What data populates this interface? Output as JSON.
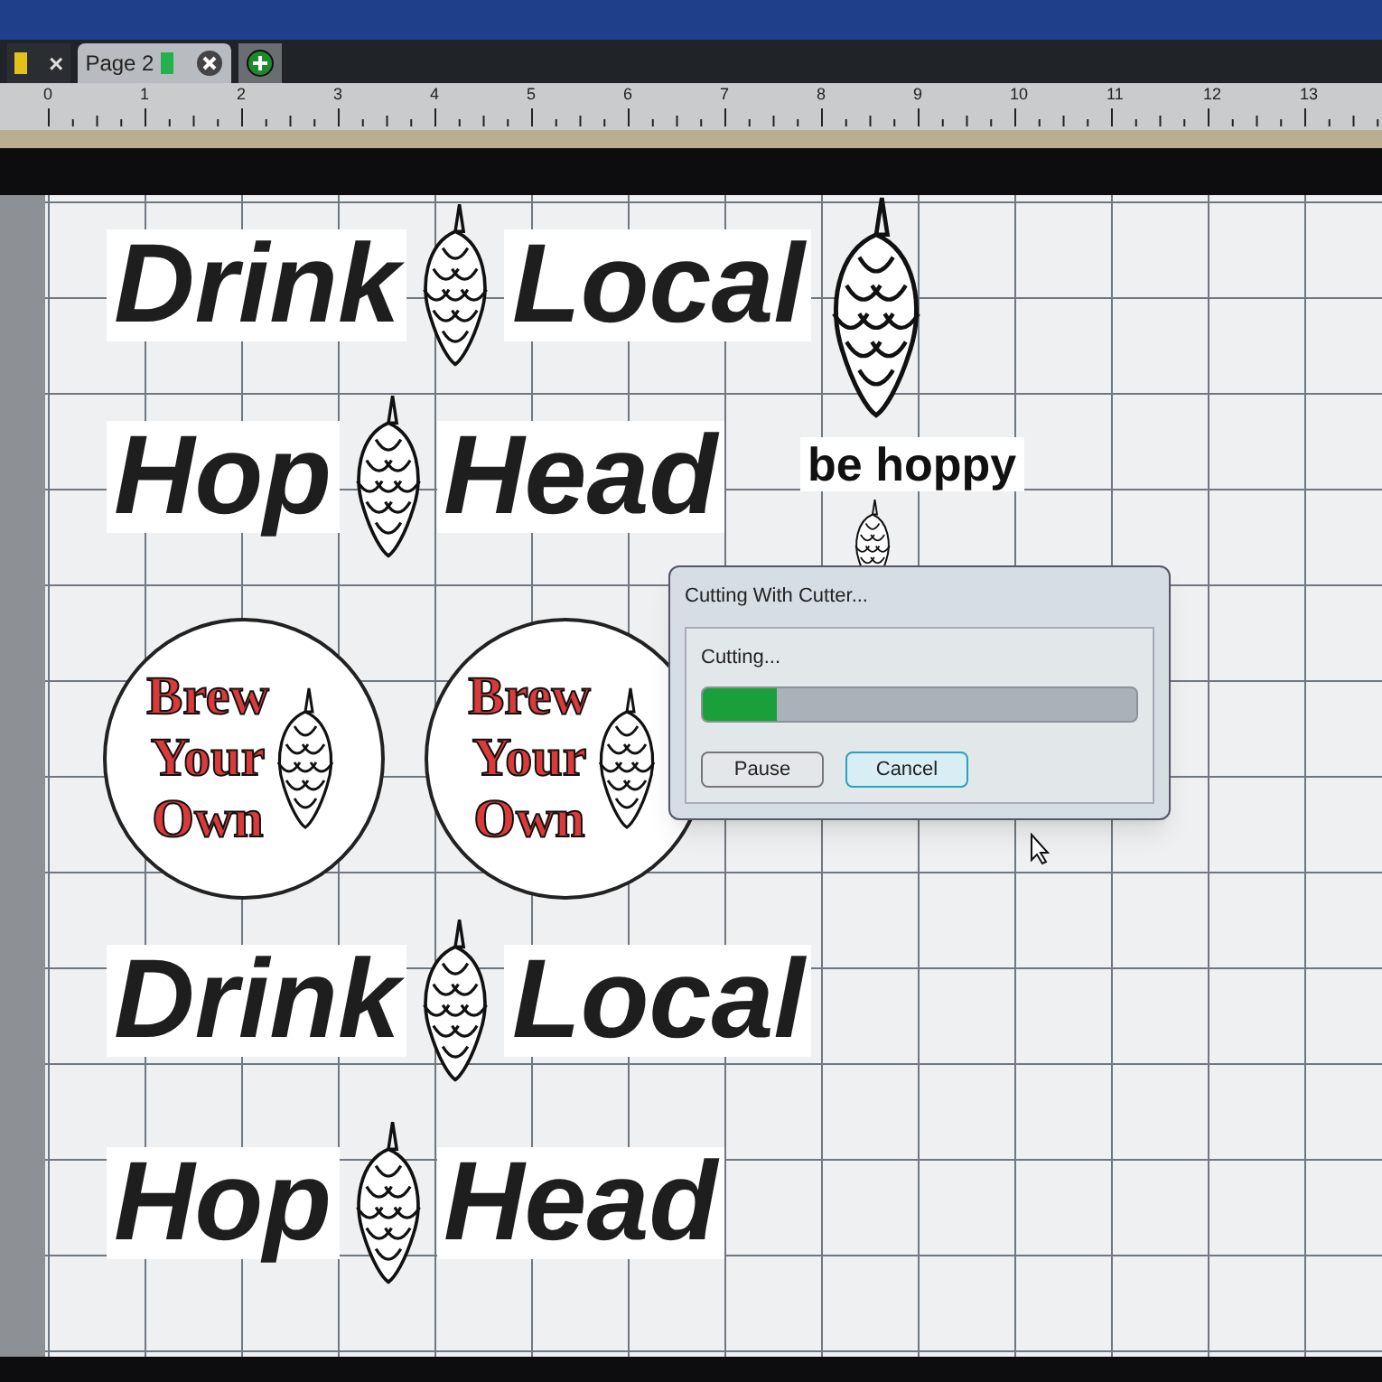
{
  "tabs": [
    {
      "kind": "partial",
      "label": "×",
      "color": "#e2c21a",
      "selected": false
    },
    {
      "kind": "page",
      "label": "Page 2",
      "color": "#22b14c",
      "selected": true
    }
  ],
  "ruler": {
    "labels": [
      "0",
      "1",
      "2",
      "3",
      "4",
      "5",
      "6",
      "7",
      "8",
      "9",
      "10",
      "11",
      "12",
      "13"
    ]
  },
  "canvas": {
    "designs": [
      {
        "kind": "word_pair",
        "words": [
          "Drink",
          "Local"
        ]
      },
      {
        "kind": "hop"
      },
      {
        "kind": "word_pair",
        "words": [
          "Hop",
          "Head"
        ]
      },
      {
        "kind": "caption",
        "text": "be hoppy"
      },
      {
        "kind": "hop"
      },
      {
        "kind": "badge",
        "lines": [
          "Brew",
          "Your",
          "Own"
        ]
      },
      {
        "kind": "badge",
        "lines": [
          "Brew",
          "Your",
          "Own"
        ]
      },
      {
        "kind": "word_pair",
        "words": [
          "Drink",
          "Local"
        ]
      },
      {
        "kind": "word_pair",
        "words": [
          "Hop",
          "Head"
        ]
      }
    ]
  },
  "dialog": {
    "title": "Cutting With Cutter...",
    "status": "Cutting...",
    "level": 0.17,
    "buttons": [
      {
        "label": "Pause",
        "selected": false
      },
      {
        "label": "Cancel",
        "selected": true
      }
    ]
  }
}
